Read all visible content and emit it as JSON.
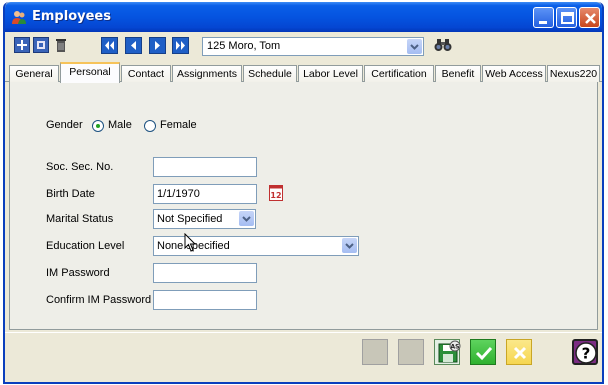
{
  "window": {
    "title": "Employees"
  },
  "toolbar": {
    "employee_selector": {
      "value": "125 Moro, Tom"
    }
  },
  "tabs": [
    {
      "label": "General"
    },
    {
      "label": "Personal"
    },
    {
      "label": "Contact"
    },
    {
      "label": "Assignments"
    },
    {
      "label": "Schedule"
    },
    {
      "label": "Labor Level"
    },
    {
      "label": "Certification"
    },
    {
      "label": "Benefit"
    },
    {
      "label": "Web Access"
    },
    {
      "label": "Nexus220"
    }
  ],
  "active_tab": "Personal",
  "form": {
    "gender": {
      "label": "Gender",
      "options": [
        "Male",
        "Female"
      ],
      "selected": "Male"
    },
    "ssn": {
      "label": "Soc. Sec. No.",
      "value": ""
    },
    "birth_date": {
      "label": "Birth Date",
      "value": "1/1/1970"
    },
    "marital_status": {
      "label": "Marital Status",
      "value": "Not Specified"
    },
    "education_level": {
      "label": "Education Level",
      "value": "None specified"
    },
    "im_password": {
      "label": "IM Password",
      "value": ""
    },
    "confirm_im_password": {
      "label": "Confirm IM Password",
      "value": ""
    }
  },
  "colors": {
    "titlebar": "#0554e0",
    "window_bg": "#ece9d8",
    "ok_green": "#2fb12f",
    "cancel_yellow": "#f6d650",
    "help_purple": "#7b2c83"
  }
}
